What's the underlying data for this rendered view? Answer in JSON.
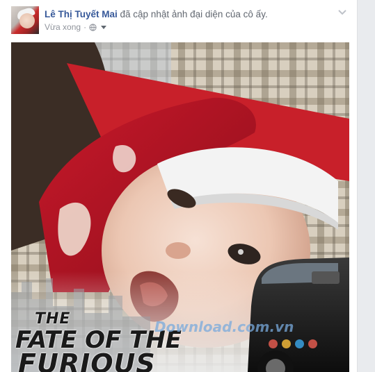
{
  "post": {
    "author": "Lê Thị Tuyết Mai",
    "action": "đã cập nhật ảnh đại diện của cô ấy.",
    "time": "Vừa xong",
    "separator": "·"
  },
  "photo": {
    "poster_line1": "THE",
    "poster_line2": "FATE OF THE",
    "poster_line3": "FURIOUS",
    "watermark": "Download.com.vn"
  },
  "icons": [
    "globe-icon",
    "caret-down-icon",
    "chevron-down-icon"
  ],
  "colors": {
    "author": "#365899",
    "text_secondary": "#616770",
    "meta": "#90949c",
    "background": "#e9ebee"
  }
}
